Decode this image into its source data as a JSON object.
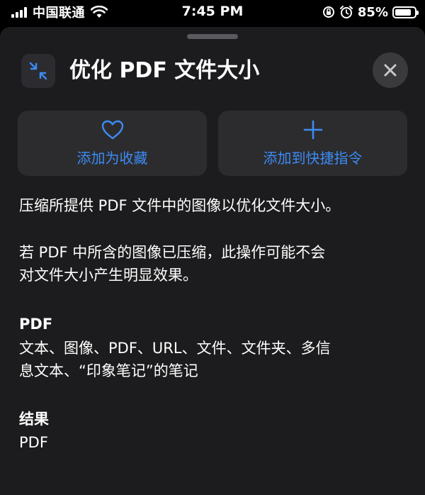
{
  "status_bar": {
    "carrier": "中国联通",
    "time": "7:45 PM",
    "battery": "85%",
    "battery_level": 0.85
  },
  "sheet": {
    "title": "优化 PDF 文件大小",
    "close_icon": "xmark-icon",
    "app_icon": "arrows-inward-icon"
  },
  "actions": {
    "favorite_label": "添加为收藏",
    "favorite_icon": "heart-icon",
    "shortcut_label": "添加到快捷指令",
    "shortcut_icon": "plus-icon"
  },
  "description": {
    "line1": "压缩所提供 PDF 文件中的图像以优化文件大小。",
    "line2a": "若 PDF 中所含的图像已压缩，此操作可能不会",
    "line2b": "对文件大小产生明显效果。"
  },
  "input_section": {
    "heading": "PDF",
    "line1": "文本、图像、PDF、URL、文件、文件夹、多信",
    "line2": "息文本、“印象笔记”的笔记"
  },
  "result_section": {
    "heading": "结果",
    "value": "PDF"
  },
  "colors": {
    "accent": "#3d8bf5",
    "sheet_bg": "#1c1c1e",
    "button_bg": "#2c2c2e"
  }
}
